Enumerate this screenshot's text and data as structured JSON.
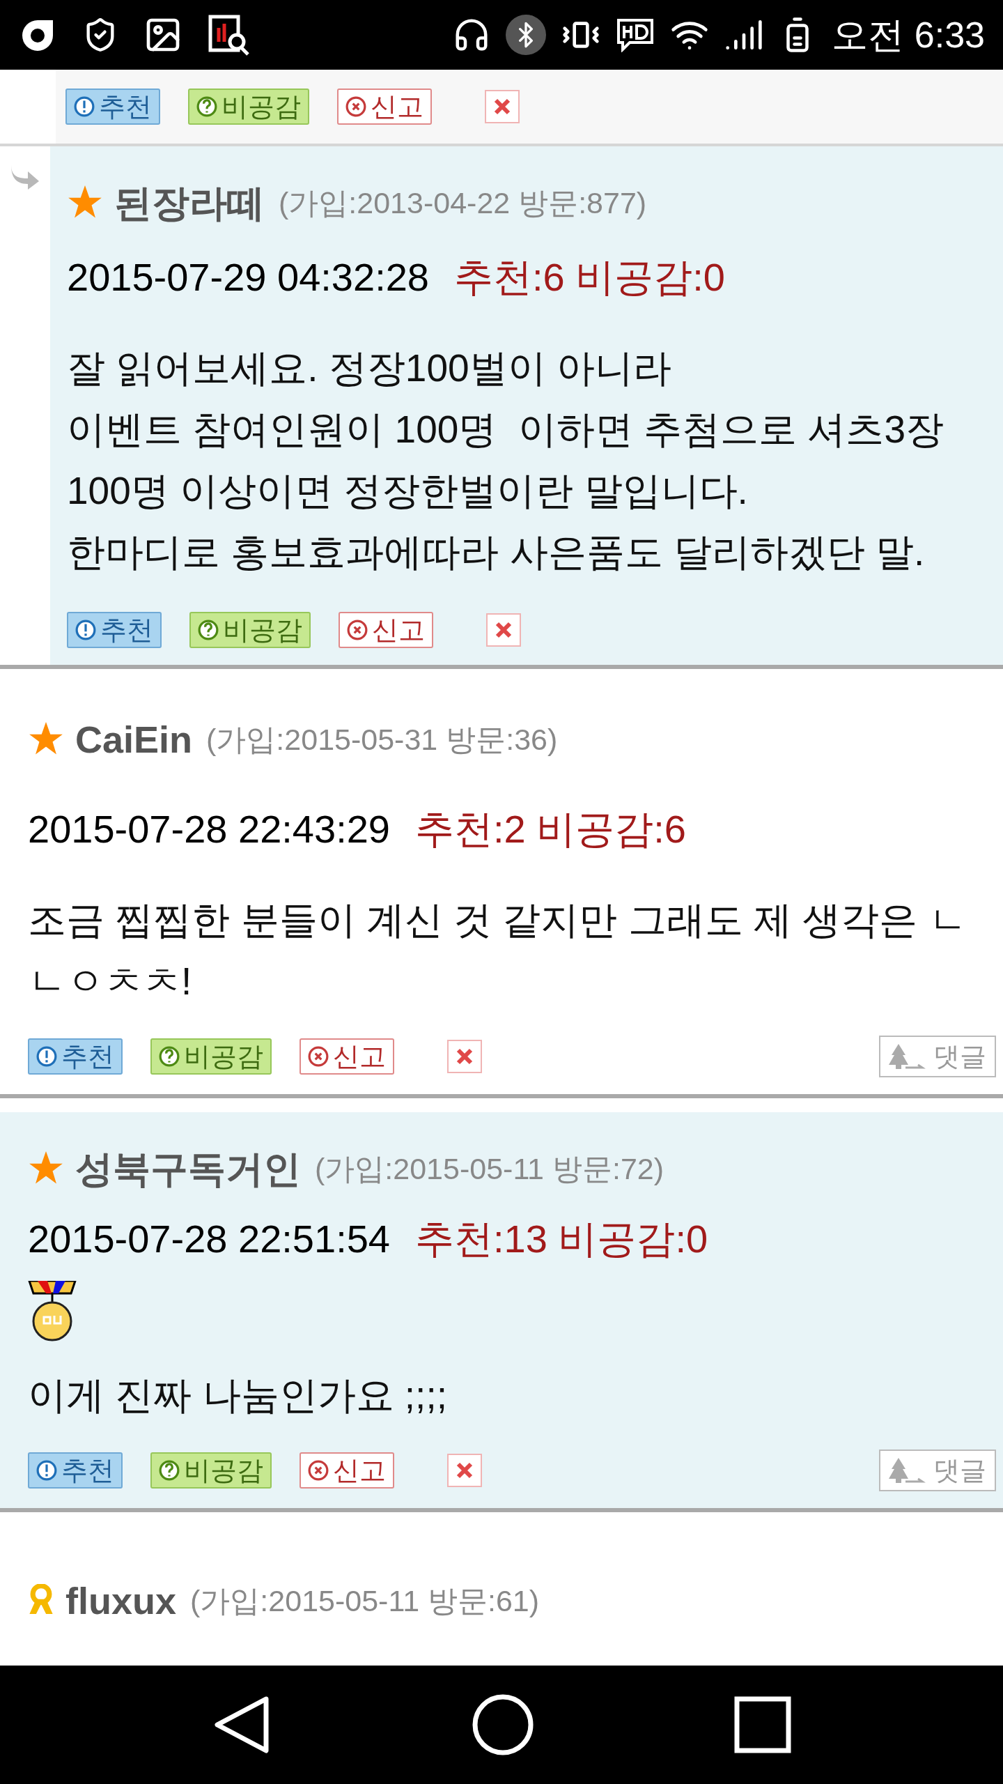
{
  "status_bar": {
    "time": "오전 6:33"
  },
  "top_actions": {
    "buttons": [
      {
        "kind": "recommend",
        "label": "추천"
      },
      {
        "kind": "disagree",
        "label": "비공감"
      },
      {
        "kind": "report",
        "label": "신고"
      },
      {
        "kind": "delete"
      }
    ]
  },
  "comments": [
    {
      "is_reply": true,
      "shaded": true,
      "badge": {
        "kind": "star"
      },
      "name": "된장라떼",
      "meta": "(가입:2013-04-22 방문:877)",
      "date": "2015-07-29 04:32:28",
      "votes": "추천:6 비공감:0",
      "medal": false,
      "body": [
        "잘 읽어보세요. 정장100벌이 아니라",
        "이벤트 참여인원이 100명  이하면 추첨으로 셔츠3장",
        "100명 이상이면 정장한벌이란 말입니다.",
        "한마디로 홍보효과에따라 사은품도 달리하겠단 말."
      ],
      "buttons": [
        {
          "kind": "recommend",
          "label": "추천"
        },
        {
          "kind": "disagree",
          "label": "비공감"
        },
        {
          "kind": "report",
          "label": "신고"
        },
        {
          "kind": "delete"
        }
      ]
    },
    {
      "is_reply": false,
      "shaded": false,
      "badge": {
        "kind": "star"
      },
      "name": "CaiEin",
      "meta": "(가입:2015-05-31 방문:36)",
      "date": "2015-07-28 22:43:29",
      "votes": "추천:2 비공감:6",
      "medal": false,
      "body": [
        "조금 찝찝한 분들이 계신 것 같지만 그래도 제 생각은 ㄴ",
        "ㄴㅇㅊㅊ!"
      ],
      "buttons": [
        {
          "kind": "recommend",
          "label": "추천"
        },
        {
          "kind": "disagree",
          "label": "비공감"
        },
        {
          "kind": "report",
          "label": "신고"
        },
        {
          "kind": "delete"
        }
      ],
      "reply_button": "댓글"
    },
    {
      "is_reply": false,
      "shaded": true,
      "badge": {
        "kind": "star"
      },
      "name": "성북구독거인",
      "meta": "(가입:2015-05-11 방문:72)",
      "date": "2015-07-28 22:51:54",
      "votes": "추천:13 비공감:0",
      "medal": true,
      "body": [
        "이게 진짜 나눔인가요 ;;;;"
      ],
      "buttons": [
        {
          "kind": "recommend",
          "label": "추천"
        },
        {
          "kind": "disagree",
          "label": "비공감"
        },
        {
          "kind": "report",
          "label": "신고"
        },
        {
          "kind": "delete"
        }
      ],
      "reply_button": "댓글"
    },
    {
      "is_reply": false,
      "shaded": false,
      "badge": {
        "kind": "ribbon"
      },
      "name": "fluxux",
      "meta": "(가입:2015-05-11 방문:61)"
    }
  ],
  "nav_bar": {
    "buttons": [
      {
        "kind": "back"
      },
      {
        "kind": "home"
      },
      {
        "kind": "recents"
      }
    ]
  }
}
